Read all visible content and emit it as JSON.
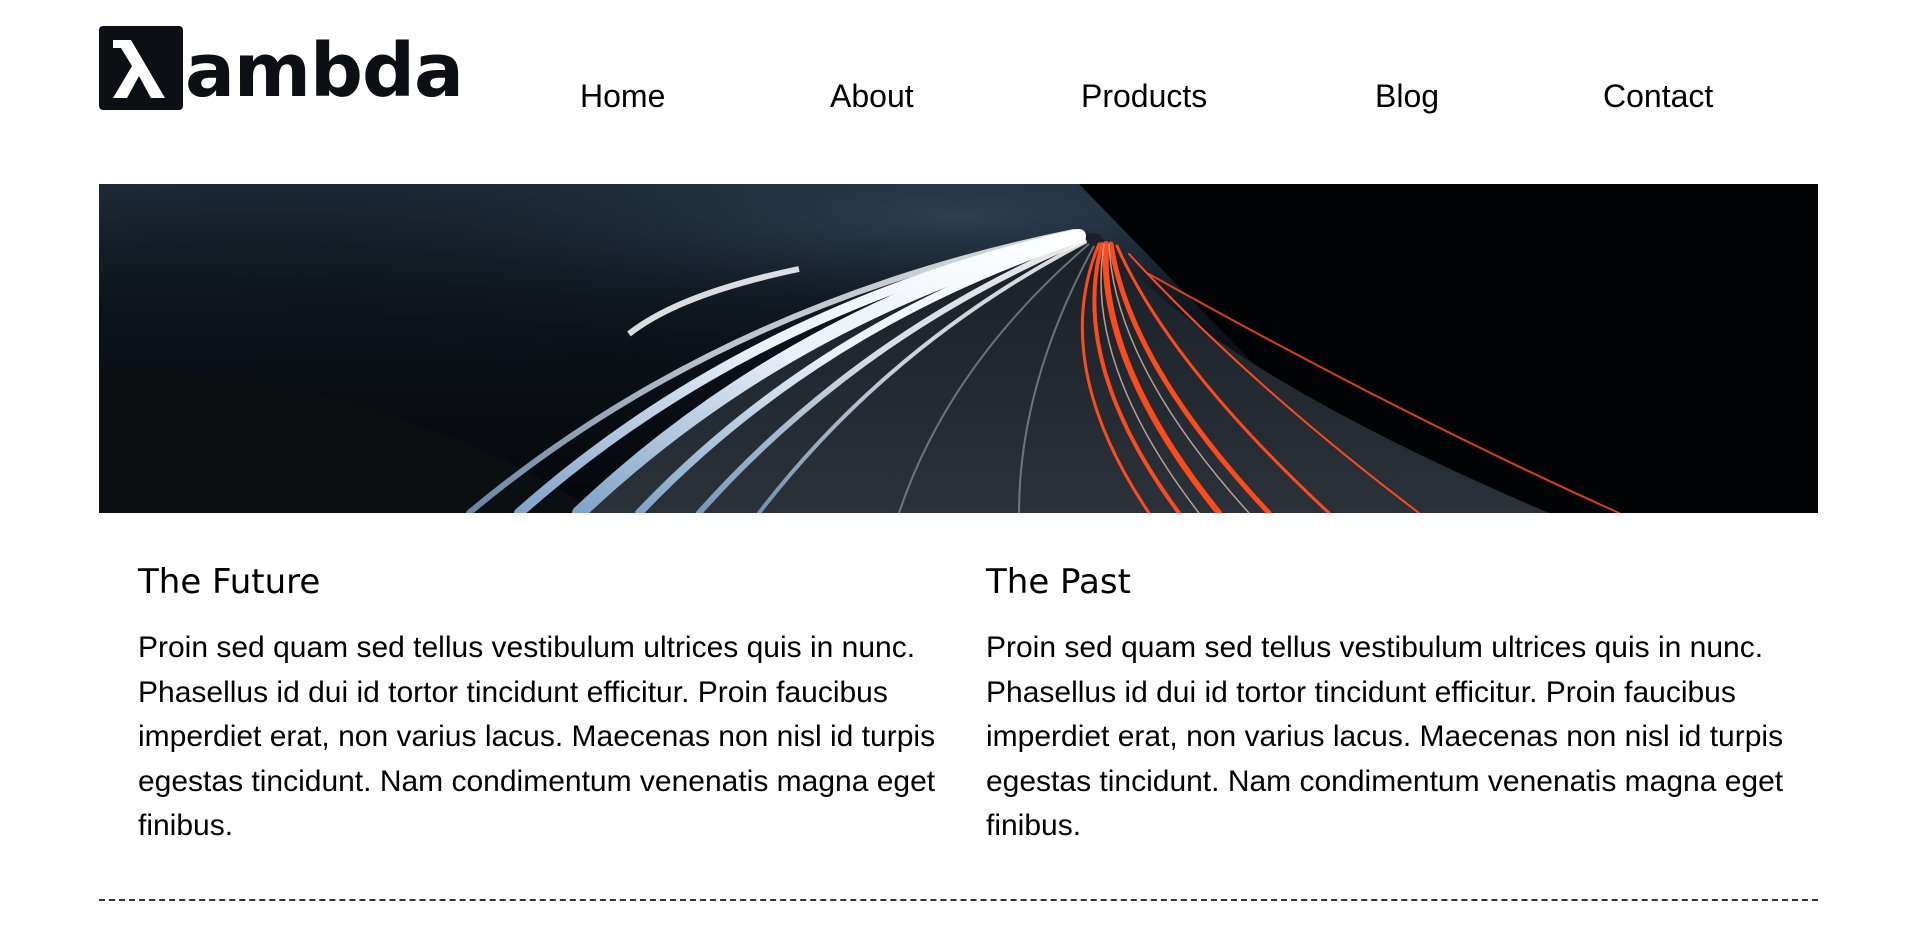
{
  "header": {
    "logo_text": "ambda",
    "logo_mark_glyph": "λ",
    "nav": [
      {
        "label": "Home"
      },
      {
        "label": "About"
      },
      {
        "label": "Products"
      },
      {
        "label": "Blog"
      },
      {
        "label": "Contact"
      }
    ]
  },
  "hero": {
    "image_subject": "night highway long-exposure light trails"
  },
  "columns": [
    {
      "title": "The Future",
      "body": "Proin sed quam sed tellus vestibulum ultrices quis in nunc. Phasellus id dui id tortor tincidunt efficitur. Proin faucibus imperdiet erat, non varius lacus. Maecenas non nisl id turpis egestas tincidunt. Nam condimentum venenatis magna eget finibus."
    },
    {
      "title": "The Past",
      "body": "Proin sed quam sed tellus vestibulum ultrices quis in nunc. Phasellus id dui id tortor tincidunt efficitur. Proin faucibus imperdiet erat, non varius lacus. Maecenas non nisl id turpis egestas tincidunt. Nam condimentum venenatis magna eget finibus."
    }
  ],
  "colors": {
    "logo": "#0c0f14",
    "text": "#000000",
    "divider": "#333333",
    "trail_white": "#e8eef6",
    "trail_red": "#ff4a1c"
  }
}
